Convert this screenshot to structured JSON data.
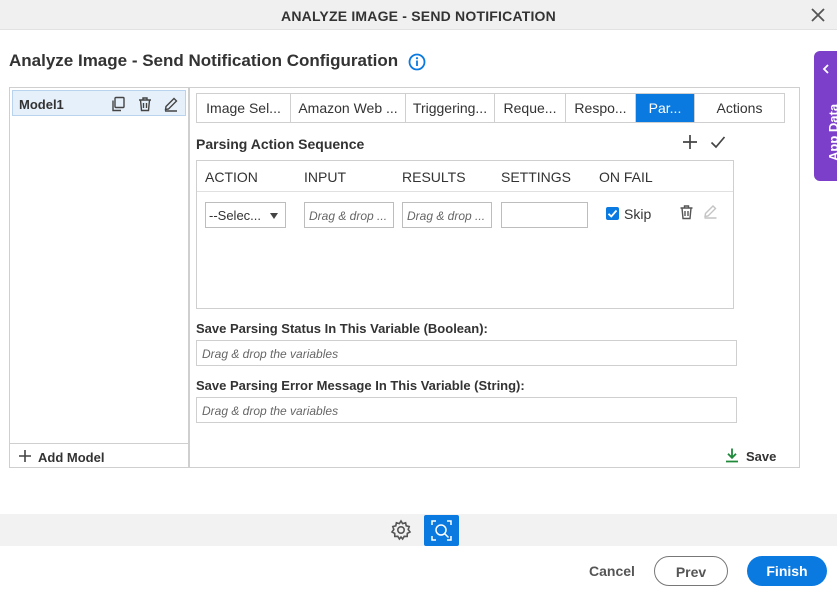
{
  "window": {
    "title": "ANALYZE IMAGE - SEND NOTIFICATION",
    "close_icon": "close-icon"
  },
  "page": {
    "heading": "Analyze Image - Send Notification Configuration",
    "info_icon": "info-icon"
  },
  "app_data": {
    "label": "App Data"
  },
  "models": {
    "items": [
      {
        "name": "Model1"
      }
    ],
    "add_label": "Add Model"
  },
  "tabs": [
    {
      "label": "Image Sel...",
      "active": false
    },
    {
      "label": "Amazon Web ...",
      "active": false
    },
    {
      "label": "Triggering...",
      "active": false
    },
    {
      "label": "Reque...",
      "active": false
    },
    {
      "label": "Respo...",
      "active": false
    },
    {
      "label": "Par...",
      "active": true
    },
    {
      "label": "Actions",
      "active": false
    }
  ],
  "parsing": {
    "title": "Parsing Action Sequence",
    "columns": [
      "ACTION",
      "INPUT",
      "RESULTS",
      "SETTINGS",
      "ON FAIL"
    ],
    "row": {
      "action": "--Selec...",
      "input_placeholder": "Drag & drop ...",
      "results_placeholder": "Drag & drop ...",
      "settings": "",
      "on_fail_checked": true,
      "on_fail_label": "Skip"
    }
  },
  "status_var": {
    "label": "Save Parsing Status In This Variable (Boolean):",
    "placeholder": "Drag & drop the variables"
  },
  "error_var": {
    "label": "Save Parsing Error Message In This Variable (String):",
    "placeholder": "Drag & drop the variables"
  },
  "save_label": "Save",
  "footer": {
    "cancel": "Cancel",
    "prev": "Prev",
    "finish": "Finish"
  },
  "colors": {
    "accent": "#0a7ae0",
    "app_data": "#7b3fc9",
    "save_icon": "#1e8a3a"
  }
}
